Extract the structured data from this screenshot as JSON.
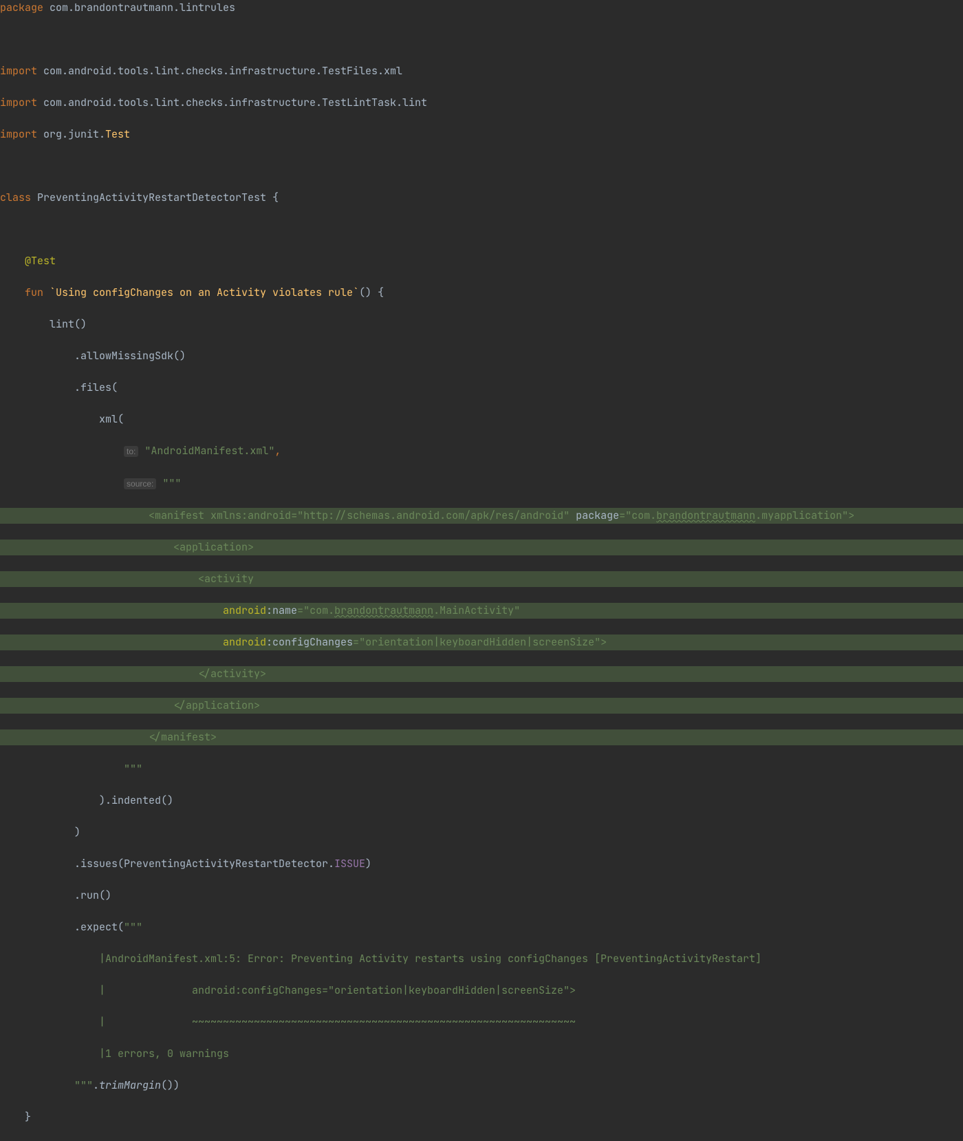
{
  "line1": {
    "kw": "package",
    "rest": " com.brandontrautmann.lintrules"
  },
  "line3": {
    "kw": "import",
    "rest": " com.android.tools.lint.checks.infrastructure.TestFiles.xml"
  },
  "line4": {
    "kw": "import",
    "rest": " com.android.tools.lint.checks.infrastructure.TestLintTask.lint"
  },
  "line5": {
    "kw": "import",
    "mid": " org.junit.",
    "cls": "Test"
  },
  "line7": {
    "kw": "class",
    "name": " PreventingActivityRestartDetectorTest {"
  },
  "line9": {
    "ann": "@Test"
  },
  "line10": {
    "kw": "fun",
    "name": " `Using configChanges on an Activity violates rule`",
    "rest": "() {"
  },
  "line11": "        lint()",
  "line12": "            .allowMissingSdk()",
  "line13": "            .files(",
  "line14": "                xml(",
  "line15": {
    "hint": "to:",
    "str": " \"AndroidManifest.xml\"",
    "comma": ","
  },
  "line16": {
    "hint": "source:",
    "str": " \"\"\""
  },
  "line17": {
    "pre": "                        ",
    "tag1": "<manifest ",
    "attr1a": "xmlns",
    "attr1b": ":android",
    "eq1": "=",
    "val1": "\"http://schemas.android.com/apk/res/android\"",
    "sp": " ",
    "attr2": "package",
    "eq2": "=",
    "val2a": "\"com.",
    "val2b": "brandontrautmann",
    "val2c": ".myapplication\"",
    "end": ">"
  },
  "line18": "                            <application>",
  "line19": "                                <activity",
  "line20": {
    "pre": "                                    ",
    "attr1": "android",
    "attr2": ":name",
    "eq": "=",
    "val1": "\"com.",
    "val2": "brandontrautmann",
    "val3": ".MainActivity\""
  },
  "line21": {
    "pre": "                                    ",
    "attr1": "android",
    "attr2": ":configChanges",
    "eq": "=",
    "val": "\"orientation|keyboardHidden|screenSize\"",
    "end": ">"
  },
  "line22": "                                </activity>",
  "line23": "                            </application>",
  "line24": "                        </manifest>",
  "line25": "                    \"\"\"",
  "line26": "                ).indented()",
  "line27": "            )",
  "line28a": "            .issues(PreventingActivityRestartDetector.",
  "line28b": "ISSUE",
  "line28c": ")",
  "line29": "            .run()",
  "line30a": "            .expect(",
  "line30b": "\"\"\"",
  "line31": "                |AndroidManifest.xml:5: Error: Preventing Activity restarts using configChanges [PreventingActivityRestart]",
  "line32": "                |              android:configChanges=\"orientation|keyboardHidden|screenSize\">",
  "line33": "                |              ~~~~~~~~~~~~~~~~~~~~~~~~~~~~~~~~~~~~~~~~~~~~~~~~~~~~~~~~~~~~~~",
  "line34": "                |1 errors, 0 warnings",
  "line35a": "            \"\"\"",
  "line35b": ".",
  "line35c": "trimMargin",
  "line35d": "())",
  "line36": "    }"
}
